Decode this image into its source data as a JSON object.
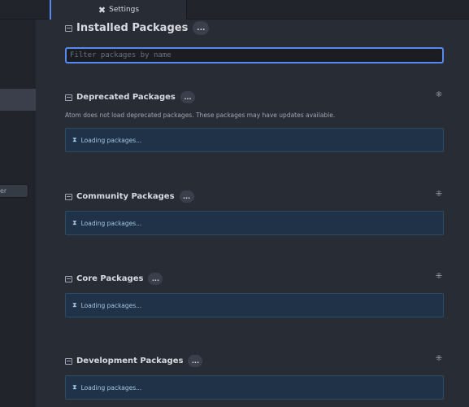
{
  "tab": {
    "icon": "tools-icon",
    "label": "Settings"
  },
  "sidebar": {
    "field_value": "er"
  },
  "installed": {
    "title": "Installed Packages",
    "badge": "...",
    "filter_placeholder": "Filter packages by name",
    "filter_value": ""
  },
  "sections": {
    "deprecated": {
      "title": "Deprecated Packages",
      "badge": "...",
      "description": "Atom does not load deprecated packages. These packages may have updates available.",
      "loading": "Loading packages..."
    },
    "community": {
      "title": "Community Packages",
      "badge": "...",
      "loading": "Loading packages..."
    },
    "core": {
      "title": "Core Packages",
      "badge": "...",
      "loading": "Loading packages..."
    },
    "development": {
      "title": "Development Packages",
      "badge": "...",
      "loading": "Loading packages..."
    }
  },
  "colors": {
    "background": "#282c34",
    "accent": "#568af2",
    "loading_panel": "#1f3247"
  }
}
